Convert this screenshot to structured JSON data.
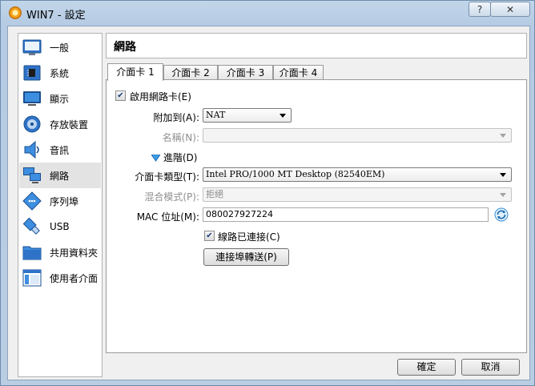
{
  "window": {
    "title": "WIN7 - 設定",
    "help_label": "?",
    "close_label": "✕"
  },
  "sidebar": {
    "items": [
      {
        "label": "一般",
        "icon": "general-icon"
      },
      {
        "label": "系統",
        "icon": "system-chip-icon"
      },
      {
        "label": "顯示",
        "icon": "display-monitor-icon"
      },
      {
        "label": "存放裝置",
        "icon": "storage-disk-icon"
      },
      {
        "label": "音訊",
        "icon": "speaker-icon"
      },
      {
        "label": "網路",
        "icon": "network-icon",
        "selected": true
      },
      {
        "label": "序列埠",
        "icon": "serial-port-icon"
      },
      {
        "label": "USB",
        "icon": "usb-icon"
      },
      {
        "label": "共用資料夾",
        "icon": "shared-folder-icon"
      },
      {
        "label": "使用者介面",
        "icon": "user-interface-icon"
      }
    ]
  },
  "header": {
    "title": "網路"
  },
  "tabs": [
    {
      "label": "介面卡 1",
      "active": true
    },
    {
      "label": "介面卡 2"
    },
    {
      "label": "介面卡 3"
    },
    {
      "label": "介面卡 4"
    }
  ],
  "adapter": {
    "enable_label": "啟用網路卡(E)",
    "enable_checked": true,
    "attached_label": "附加到(A):",
    "attached_value": "NAT",
    "name_label": "名稱(N):",
    "name_value": "",
    "advanced_label": "進階(D)",
    "type_label": "介面卡類型(T):",
    "type_value": "Intel PRO/1000 MT Desktop (82540EM)",
    "promisc_label": "混合模式(P):",
    "promisc_value": "拒絕",
    "mac_label": "MAC 位址(M):",
    "mac_value": "080027927224",
    "cable_label": "線路已連接(C)",
    "cable_checked": true,
    "port_forward_label": "連接埠轉送(P)"
  },
  "footer": {
    "ok_label": "確定",
    "cancel_label": "取消"
  },
  "colors": {
    "accent": "#2f73c8",
    "selected_bg": "#e3e3e3"
  }
}
